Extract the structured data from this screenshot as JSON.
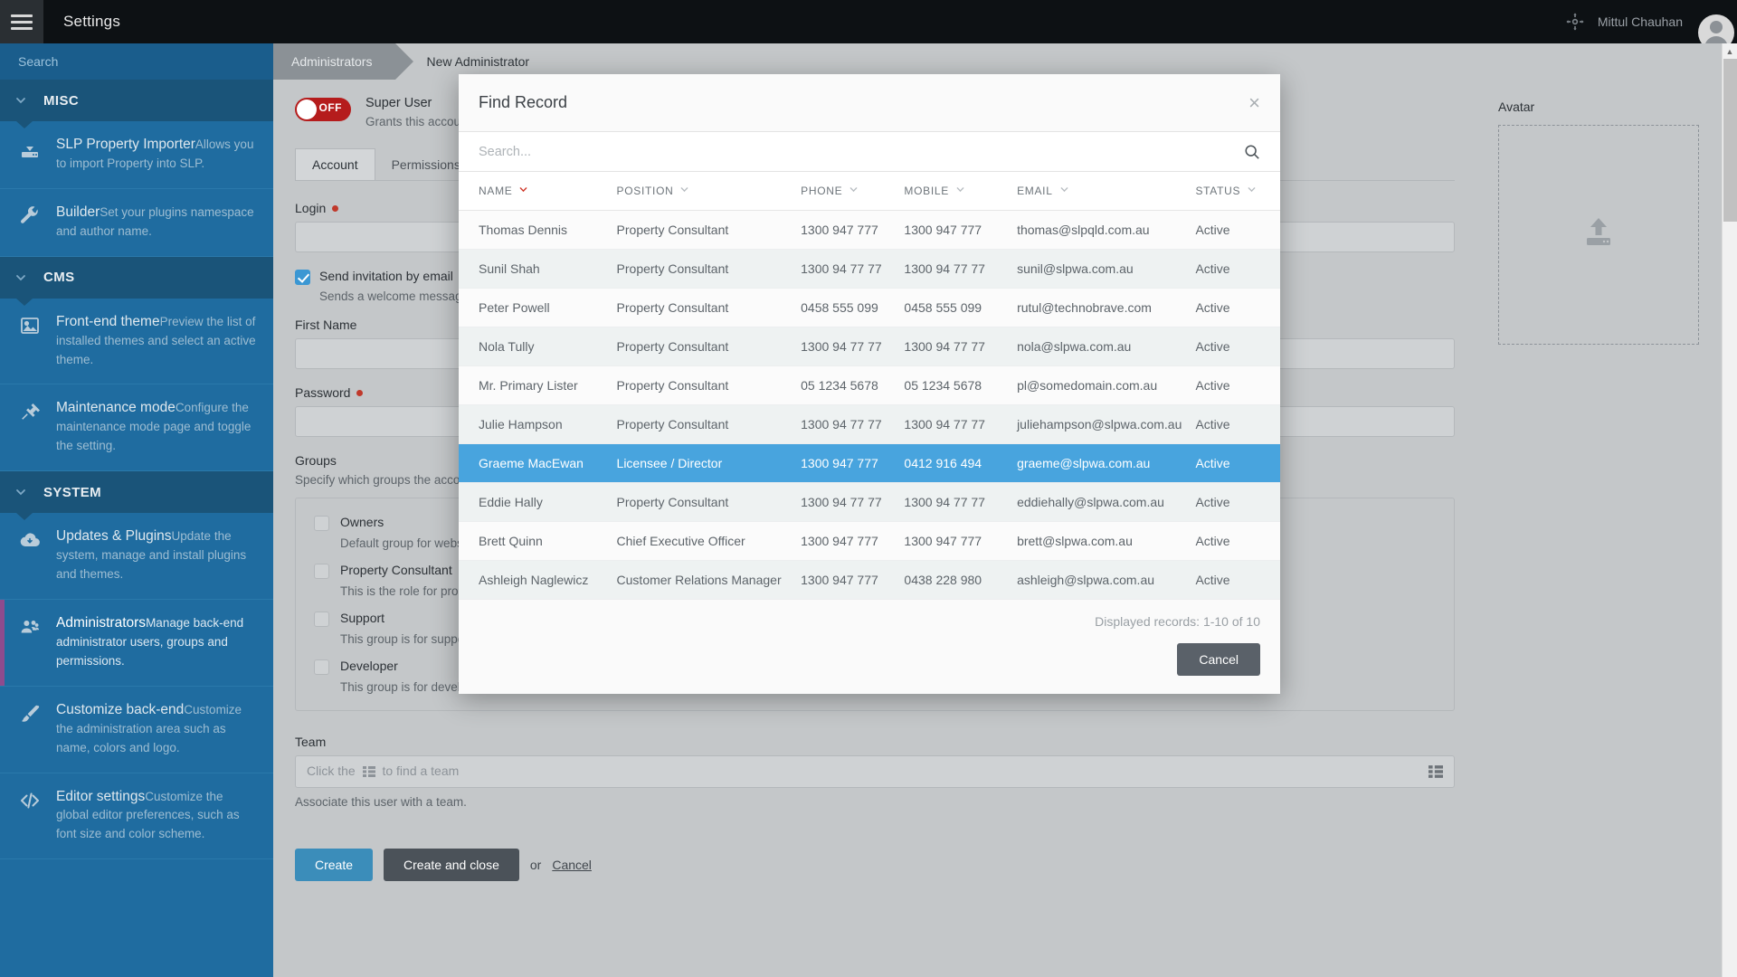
{
  "topbar": {
    "app_title": "Settings",
    "user_name": "Mittul Chauhan",
    "move_icon": "move-icon",
    "hamburger_icon": "hamburger-icon",
    "avatar_icon": "user-avatar-icon"
  },
  "sidebar": {
    "search_placeholder": "Search",
    "groups": [
      {
        "label": "MISC",
        "items": [
          {
            "icon": "download-box-icon",
            "title": "SLP Property Importer",
            "desc": "Allows you to import Property into SLP.",
            "active": false
          },
          {
            "icon": "wrench-icon",
            "title": "Builder",
            "desc": "Set your plugins namespace and author name.",
            "active": false
          }
        ]
      },
      {
        "label": "CMS",
        "items": [
          {
            "icon": "image-icon",
            "title": "Front-end theme",
            "desc": "Preview the list of installed themes and select an active theme.",
            "active": false
          },
          {
            "icon": "plug-icon",
            "title": "Maintenance mode",
            "desc": "Configure the maintenance mode page and toggle the setting.",
            "active": false
          }
        ]
      },
      {
        "label": "SYSTEM",
        "items": [
          {
            "icon": "cloud-download-icon",
            "title": "Updates & Plugins",
            "desc": "Update the system, manage and install plugins and themes.",
            "active": false
          },
          {
            "icon": "users-icon",
            "title": "Administrators",
            "desc": "Manage back-end administrator users, groups and permissions.",
            "active": true
          },
          {
            "icon": "paintbrush-icon",
            "title": "Customize back-end",
            "desc": "Customize the administration area such as name, colors and logo.",
            "active": false
          },
          {
            "icon": "code-icon",
            "title": "Editor settings",
            "desc": "Customize the global editor preferences, such as font size and color scheme.",
            "active": false
          }
        ]
      }
    ]
  },
  "breadcrumb": {
    "first": "Administrators",
    "second": "New Administrator"
  },
  "form": {
    "super_user": {
      "toggle_state": "OFF",
      "title": "Super User",
      "desc": "Grants this accou",
      "color": "#b51c1c"
    },
    "tabs": [
      {
        "label": "Account",
        "active": true
      },
      {
        "label": "Permissions",
        "active": false
      }
    ],
    "login_label": "Login",
    "login_value": "",
    "invite_checkbox": {
      "checked": true,
      "label": "Send invitation by email",
      "desc": "Sends a welcome messag"
    },
    "first_name_label": "First Name",
    "first_name_value": "",
    "password_label": "Password",
    "password_value": "",
    "groups_title": "Groups",
    "groups_desc": "Specify which groups the accou",
    "groups": [
      {
        "label": "Owners",
        "desc": "Default group for webs",
        "checked": false
      },
      {
        "label": "Property Consultant",
        "desc": "This is the role for prop",
        "checked": false
      },
      {
        "label": "Support",
        "desc": "This group is for suppo",
        "checked": false
      },
      {
        "label": "Developer",
        "desc": "This group is for developer users.",
        "checked": false
      }
    ],
    "team_label": "Team",
    "team_placeholder_pre": "Click the",
    "team_placeholder_post": "to find a team",
    "team_help": "Associate this user with a team.",
    "buttons": {
      "create": "Create",
      "create_and_close": "Create and close",
      "or": "or",
      "cancel": "Cancel"
    }
  },
  "right_panel": {
    "title": "Avatar",
    "upload_icon": "upload-icon"
  },
  "modal": {
    "title": "Find Record",
    "close_icon": "close-icon",
    "search_placeholder": "Search...",
    "search_icon": "search-icon",
    "columns": [
      {
        "label": "NAME",
        "sorted": true
      },
      {
        "label": "POSITION",
        "sorted": false
      },
      {
        "label": "PHONE",
        "sorted": false
      },
      {
        "label": "MOBILE",
        "sorted": false
      },
      {
        "label": "EMAIL",
        "sorted": false
      },
      {
        "label": "STATUS",
        "sorted": false
      }
    ],
    "rows": [
      {
        "name": "Thomas Dennis",
        "position": "Property Consultant",
        "phone": "1300 947 777",
        "mobile": "1300 947 777",
        "email": "thomas@slpqld.com.au",
        "status": "Active",
        "selected": false
      },
      {
        "name": "Sunil Shah",
        "position": "Property Consultant",
        "phone": "1300 94 77 77",
        "mobile": "1300 94 77 77",
        "email": "sunil@slpwa.com.au",
        "status": "Active",
        "selected": false
      },
      {
        "name": "Peter Powell",
        "position": "Property Consultant",
        "phone": "0458 555 099",
        "mobile": "0458 555 099",
        "email": "rutul@technobrave.com",
        "status": "Active",
        "selected": false
      },
      {
        "name": "Nola Tully",
        "position": "Property Consultant",
        "phone": "1300 94 77 77",
        "mobile": "1300 94 77 77",
        "email": "nola@slpwa.com.au",
        "status": "Active",
        "selected": false
      },
      {
        "name": "Mr. Primary Lister",
        "position": "Property Consultant",
        "phone": "05 1234 5678",
        "mobile": "05 1234 5678",
        "email": "pl@somedomain.com.au",
        "status": "Active",
        "selected": false
      },
      {
        "name": "Julie Hampson",
        "position": "Property Consultant",
        "phone": "1300 94 77 77",
        "mobile": "1300 94 77 77",
        "email": "juliehampson@slpwa.com.au",
        "status": "Active",
        "selected": false
      },
      {
        "name": "Graeme MacEwan",
        "position": "Licensee / Director",
        "phone": "1300 947 777",
        "mobile": "0412 916 494",
        "email": "graeme@slpwa.com.au",
        "status": "Active",
        "selected": true
      },
      {
        "name": "Eddie Hally",
        "position": "Property Consultant",
        "phone": "1300 94 77 77",
        "mobile": "1300 94 77 77",
        "email": "eddiehally@slpwa.com.au",
        "status": "Active",
        "selected": false
      },
      {
        "name": "Brett Quinn",
        "position": "Chief Executive Officer",
        "phone": "1300 947 777",
        "mobile": "1300 947 777",
        "email": "brett@slpwa.com.au",
        "status": "Active",
        "selected": false
      },
      {
        "name": "Ashleigh Naglewicz",
        "position": "Customer Relations Manager",
        "phone": "1300 947 777",
        "mobile": "0438 228 980",
        "email": "ashleigh@slpwa.com.au",
        "status": "Active",
        "selected": false
      }
    ],
    "record_count": "Displayed records: 1-10 of 10",
    "cancel_label": "Cancel",
    "selected_row_color": "#48a4de"
  }
}
